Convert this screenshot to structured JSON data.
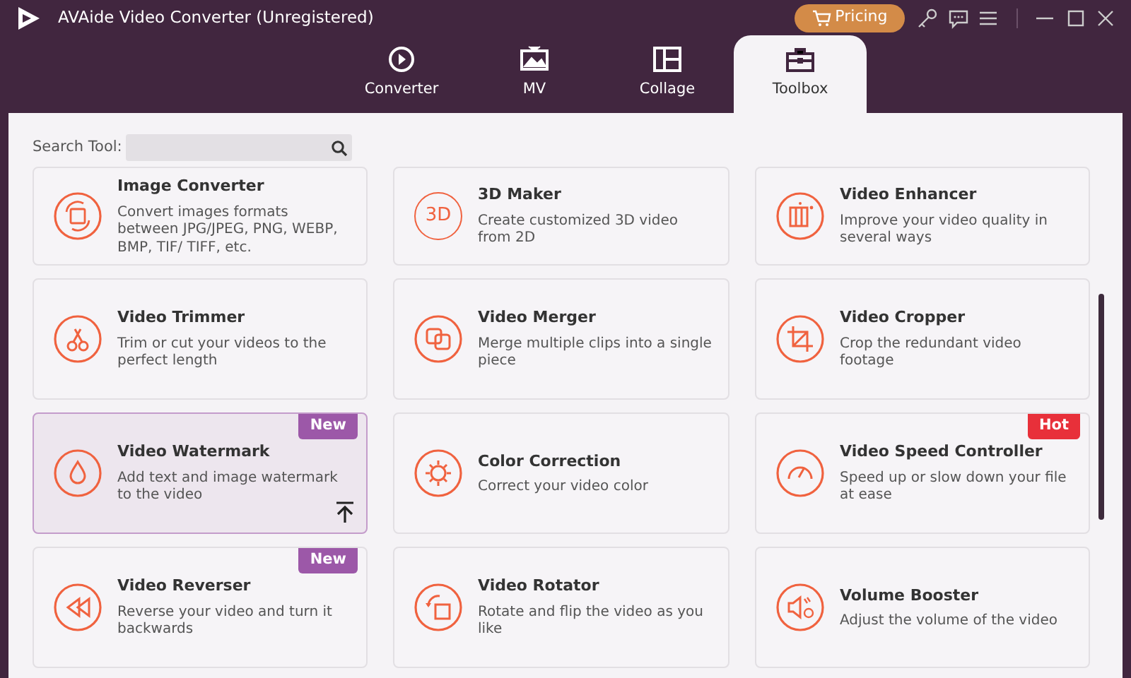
{
  "window": {
    "title": "AVAide Video Converter (Unregistered)",
    "pricing": "Pricing"
  },
  "tabs": [
    {
      "label": "Converter",
      "selected": false
    },
    {
      "label": "MV",
      "selected": false
    },
    {
      "label": "Collage",
      "selected": false
    },
    {
      "label": "Toolbox",
      "selected": true
    }
  ],
  "search": {
    "label": "Search Tool:"
  },
  "tools": [
    {
      "title": "Image Converter",
      "description": "Convert images formats between JPG/JPEG, PNG, WEBP, BMP, TIF/ TIFF, etc.",
      "selected": false
    },
    {
      "title": "3D Maker",
      "description": "Create customized 3D video from 2D",
      "selected": false,
      "icon_text": "3D"
    },
    {
      "title": "Video Enhancer",
      "description": "Improve your video quality in several ways",
      "selected": false
    },
    {
      "title": "Video Trimmer",
      "description": "Trim or cut your videos to the perfect length",
      "selected": false
    },
    {
      "title": "Video Merger",
      "description": "Merge multiple clips into a single piece",
      "selected": false
    },
    {
      "title": "Video Cropper",
      "description": "Crop the redundant video footage",
      "selected": false
    },
    {
      "title": "Video Watermark",
      "description": "Add text and image watermark to the video",
      "selected": true,
      "badge": {
        "text": "New",
        "color": "#9c58a8"
      }
    },
    {
      "title": "Color Correction",
      "description": "Correct your video color",
      "selected": false
    },
    {
      "title": "Video Speed Controller",
      "description": "Speed up or slow down your file at ease",
      "selected": false,
      "badge": {
        "text": "Hot",
        "color": "#e8303a"
      }
    },
    {
      "title": "Video Reverser",
      "description": "Reverse your video and turn it backwards",
      "selected": false,
      "badge": {
        "text": "New",
        "color": "#9c58a8"
      }
    },
    {
      "title": "Video Rotator",
      "description": "Rotate and flip the video as you like",
      "selected": false
    },
    {
      "title": "Volume Booster",
      "description": "Adjust the volume of the video",
      "selected": false
    }
  ]
}
